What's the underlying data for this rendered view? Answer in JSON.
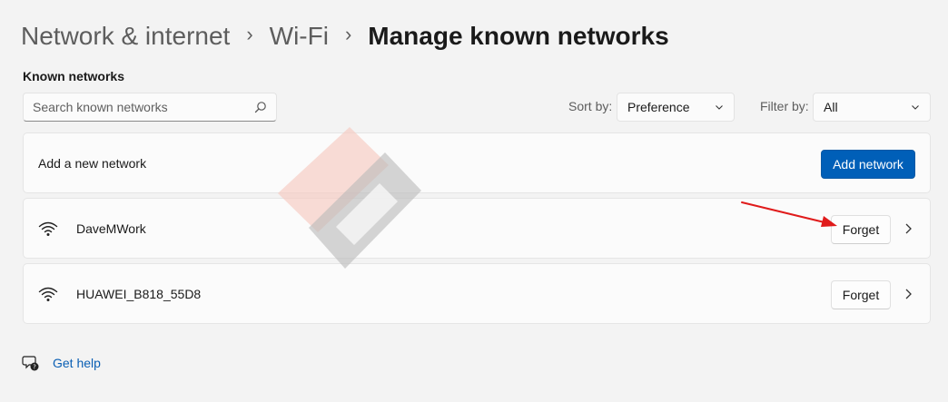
{
  "breadcrumb": {
    "items": [
      "Network & internet",
      "Wi-Fi"
    ],
    "current": "Manage known networks"
  },
  "known_networks": {
    "title": "Known networks",
    "search_placeholder": "Search known networks",
    "sort_label": "Sort by:",
    "sort_value": "Preference",
    "filter_label": "Filter by:",
    "filter_value": "All"
  },
  "add_network": {
    "label": "Add a new network",
    "button_label": "Add network"
  },
  "networks": [
    {
      "name": "DaveMWork",
      "action": "Forget",
      "icon": "wifi-icon"
    },
    {
      "name": "HUAWEI_B818_55D8",
      "action": "Forget",
      "icon": "wifi-icon"
    }
  ],
  "help": {
    "label": "Get help",
    "icon": "help-icon"
  },
  "colors": {
    "accent": "#005fb8",
    "background": "#f3f3f3",
    "card": "#fbfbfb",
    "annotation": "#e01b1b"
  }
}
